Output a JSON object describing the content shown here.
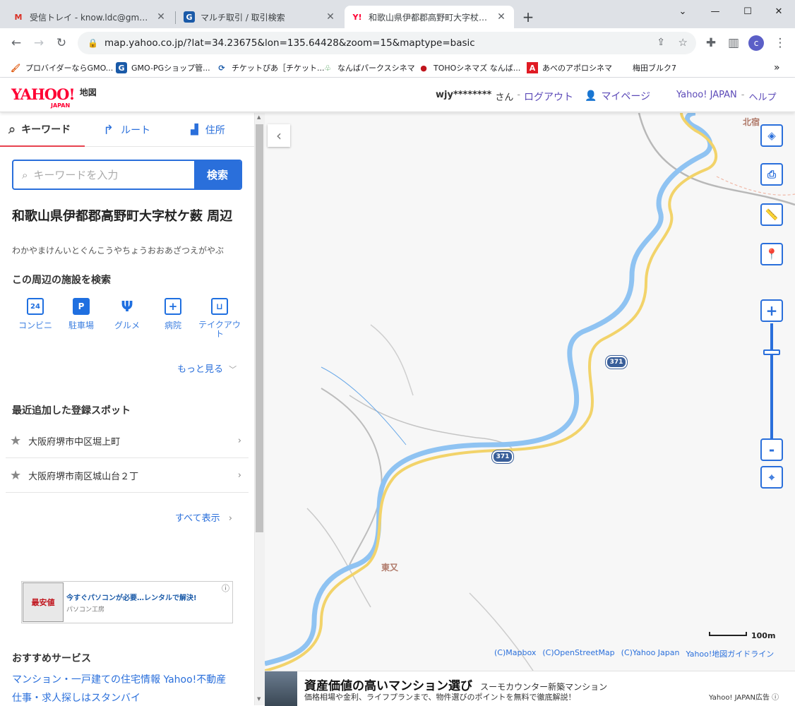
{
  "browser": {
    "tabs": [
      {
        "title": "受信トレイ - know.ldc@gmail.com",
        "icon": "gmail-icon"
      },
      {
        "title": "マルチ取引 / 取引検索",
        "icon": "gmo-icon"
      },
      {
        "title": "和歌山県伊都郡高野町大字杖ケ薮",
        "icon": "yahoo-icon"
      }
    ],
    "new_tab": "+",
    "url": "map.yahoo.co.jp/?lat=34.23675&lon=135.64428&zoom=15&maptype=basic",
    "profile_initial": "c",
    "bookmarks": [
      {
        "label": "プロバイダーならGMO...",
        "icon": "gmo-isp-icon"
      },
      {
        "label": "GMO-PGショップ管...",
        "icon": "gmo-pg-icon"
      },
      {
        "label": "チケットぴあ［チケット...",
        "icon": "pia-icon"
      },
      {
        "label": "なんばパークスシネマ",
        "icon": "tree-icon"
      },
      {
        "label": "TOHOシネマズ なんば...",
        "icon": "toho-icon"
      },
      {
        "label": "あべのアポロシネマ",
        "icon": "apollo-icon"
      },
      {
        "label": "梅田ブルク7",
        "icon": ""
      }
    ],
    "more": "»"
  },
  "header": {
    "logo": "YAHOO!",
    "logo_sub": "JAPAN",
    "logo_suffix": "地図",
    "user": "wjy********",
    "san": "さん",
    "logout": "ログアウト",
    "mypage": "マイページ",
    "yahoo_japan": "Yahoo! JAPAN",
    "help": "ヘルプ",
    "sep": "-"
  },
  "sidebar": {
    "tabs": [
      {
        "label": "キーワード",
        "icon": "search-icon"
      },
      {
        "label": "ルート",
        "icon": "route-arrow-icon"
      },
      {
        "label": "住所",
        "icon": "address-icon"
      }
    ],
    "search_placeholder": "キーワードを入力",
    "search_button": "検索",
    "place_title": "和歌山県伊都郡高野町大字杖ケ薮 周辺",
    "place_reading": "わかやまけんいとぐんこうやちょうおおあざつえがやぶ",
    "nearby_title": "この周辺の施設を検索",
    "facilities": [
      {
        "label": "コンビニ",
        "icon": "convenience-store-icon",
        "glyph": "24"
      },
      {
        "label": "駐車場",
        "icon": "parking-icon",
        "glyph": "P"
      },
      {
        "label": "グルメ",
        "icon": "fork-knife-icon",
        "glyph": "Ψ"
      },
      {
        "label": "病院",
        "icon": "hospital-icon",
        "glyph": "+"
      },
      {
        "label": "テイクアウト",
        "icon": "takeout-bag-icon",
        "glyph": "⊔"
      }
    ],
    "more_label": "もっと見る",
    "spots_title": "最近追加した登録スポット",
    "spots": [
      "大阪府堺市中区堀上町",
      "大阪府堺市南区城山台２丁"
    ],
    "show_all": "すべて表示",
    "ad_title": "今すぐパソコンが必要…レンタルで解決!",
    "ad_source": "パソコン工房",
    "ad_image_text": "最安値",
    "recommend_title": "おすすめサービス",
    "recommend_links": [
      "マンション・一戸建ての住宅情報 Yahoo!不動産",
      "仕事・求人探しはスタンバイ"
    ]
  },
  "map": {
    "collapse_arrow": "‹",
    "route_label": "371",
    "place_labels": [
      "北宿",
      "東又"
    ],
    "scale_label": "100m",
    "attribution": [
      "(C)Mapbox",
      "(C)OpenStreetMap",
      "(C)Yahoo Japan",
      "Yahoo!地図ガイドライン"
    ],
    "zoom_in": "+",
    "zoom_out": "-",
    "zoom_level_fraction": 0.3
  },
  "ad_bar": {
    "headline": "資産価値の高いマンション選び",
    "source": "スーモカウンター新築マンション",
    "body": "価格相場や金利、ライフプランまで、物件選びのポイントを無料で徹底解説！",
    "ad_label": "Yahoo! JAPAN広告"
  },
  "colors": {
    "accent": "#2a6fdb",
    "river": "#8fc3f2",
    "road": "#f2d36a",
    "yahoo_red": "#ff0033"
  }
}
